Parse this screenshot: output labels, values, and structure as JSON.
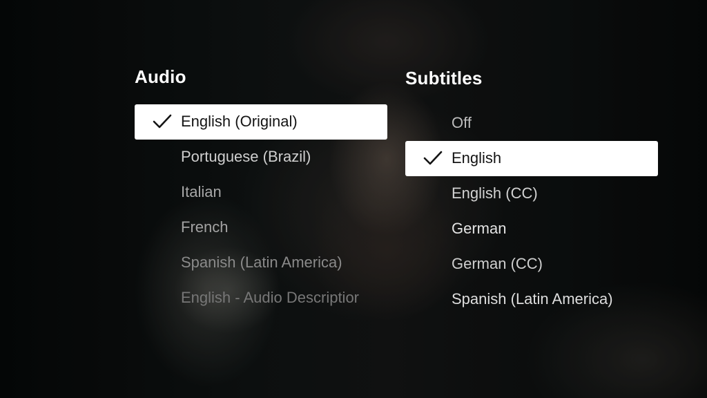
{
  "audio": {
    "title": "Audio",
    "selected_index": 0,
    "options": [
      {
        "label": "English (Original)"
      },
      {
        "label": "Portuguese (Brazil)"
      },
      {
        "label": "Italian"
      },
      {
        "label": "French"
      },
      {
        "label": "Spanish (Latin America)"
      },
      {
        "label": "English - Audio Descriptior"
      }
    ]
  },
  "subtitles": {
    "title": "Subtitles",
    "selected_index": 1,
    "options": [
      {
        "label": "Off"
      },
      {
        "label": "English"
      },
      {
        "label": "English (CC)"
      },
      {
        "label": "German"
      },
      {
        "label": "German (CC)"
      },
      {
        "label": "Spanish (Latin America)"
      }
    ]
  },
  "icons": {
    "selected_marker": "checkmark-icon"
  },
  "colors": {
    "selected_background": "#ffffff",
    "selected_text": "#141414",
    "title_text": "#ffffff"
  }
}
